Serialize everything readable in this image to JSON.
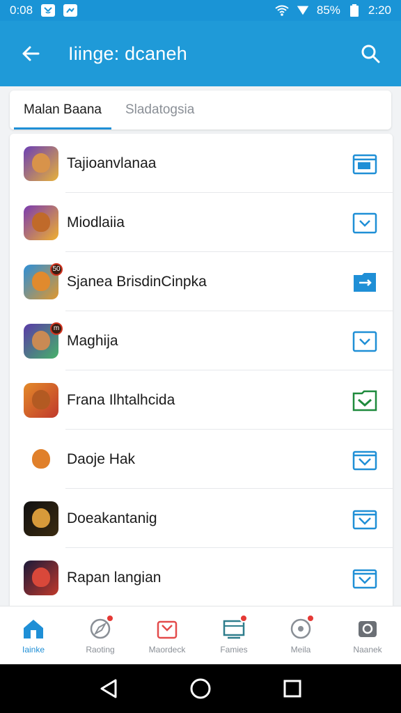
{
  "status": {
    "time": "0:08",
    "battery": "85%",
    "clock": "2:20"
  },
  "app_bar": {
    "title": "Iiinge: dcaneh",
    "back_icon": "arrow-left-icon",
    "search_icon": "search-icon"
  },
  "tabs": [
    {
      "label": "Malan Baana",
      "active": true
    },
    {
      "label": "Sladatogsia",
      "active": false
    }
  ],
  "apps": [
    {
      "name": "Tajioanvlanaa",
      "colors": [
        "#6b3fb5",
        "#e7b13a"
      ],
      "face": "#d8934a",
      "action": "folder-icon",
      "action_color": "#1f8fd6",
      "badge": ""
    },
    {
      "name": "Miodlaiia",
      "colors": [
        "#7a3bb0",
        "#f0b030"
      ],
      "face": "#c06a2a",
      "action": "chevron-box-icon",
      "action_color": "#1f8fd6",
      "badge": ""
    },
    {
      "name": "Sjanea BrisdinCinpka",
      "colors": [
        "#2c8fd8",
        "#e0972e"
      ],
      "face": "#e08a2e",
      "action": "folder-filled-icon",
      "action_color": "#1f8fd6",
      "badge": "50"
    },
    {
      "name": "Maghija",
      "colors": [
        "#5a3aa8",
        "#46b26a"
      ],
      "face": "#c98a54",
      "action": "chevron-box-icon",
      "action_color": "#1f8fd6",
      "badge": "m"
    },
    {
      "name": "Frana Ilhtalhcida",
      "colors": [
        "#e38a2a",
        "#c0392b"
      ],
      "face": "#b35a22",
      "action": "download-folder-icon",
      "action_color": "#1e8a3c",
      "badge": ""
    },
    {
      "name": "Daoje Hak",
      "colors": [
        "#ffffff",
        "#ffffff"
      ],
      "face": "#e0802a",
      "action": "download-box-icon",
      "action_color": "#1f8fd6",
      "badge": ""
    },
    {
      "name": "Doeakantanig",
      "colors": [
        "#111111",
        "#3a2a10"
      ],
      "face": "#d79a3a",
      "action": "download-box-icon",
      "action_color": "#1f8fd6",
      "badge": ""
    },
    {
      "name": "Rapan langian",
      "colors": [
        "#1a1a3a",
        "#c0392b"
      ],
      "face": "#d9483a",
      "action": "download-box-icon",
      "action_color": "#1f8fd6",
      "badge": ""
    }
  ],
  "bottom_nav": [
    {
      "label": "Iainke",
      "icon": "home-icon",
      "active": true,
      "dot": false
    },
    {
      "label": "Raoting",
      "icon": "compass-icon",
      "active": false,
      "dot": true
    },
    {
      "label": "Maordeck",
      "icon": "store-icon",
      "active": false,
      "dot": false
    },
    {
      "label": "Famies",
      "icon": "inbox-icon",
      "active": false,
      "dot": true
    },
    {
      "label": "Meila",
      "icon": "disc-icon",
      "active": false,
      "dot": true
    },
    {
      "label": "Naanek",
      "icon": "camera-icon",
      "active": false,
      "dot": false
    }
  ],
  "system_nav": {
    "back_icon": "triangle-back-icon",
    "home_icon": "circle-home-icon",
    "recents_icon": "square-recents-icon"
  }
}
